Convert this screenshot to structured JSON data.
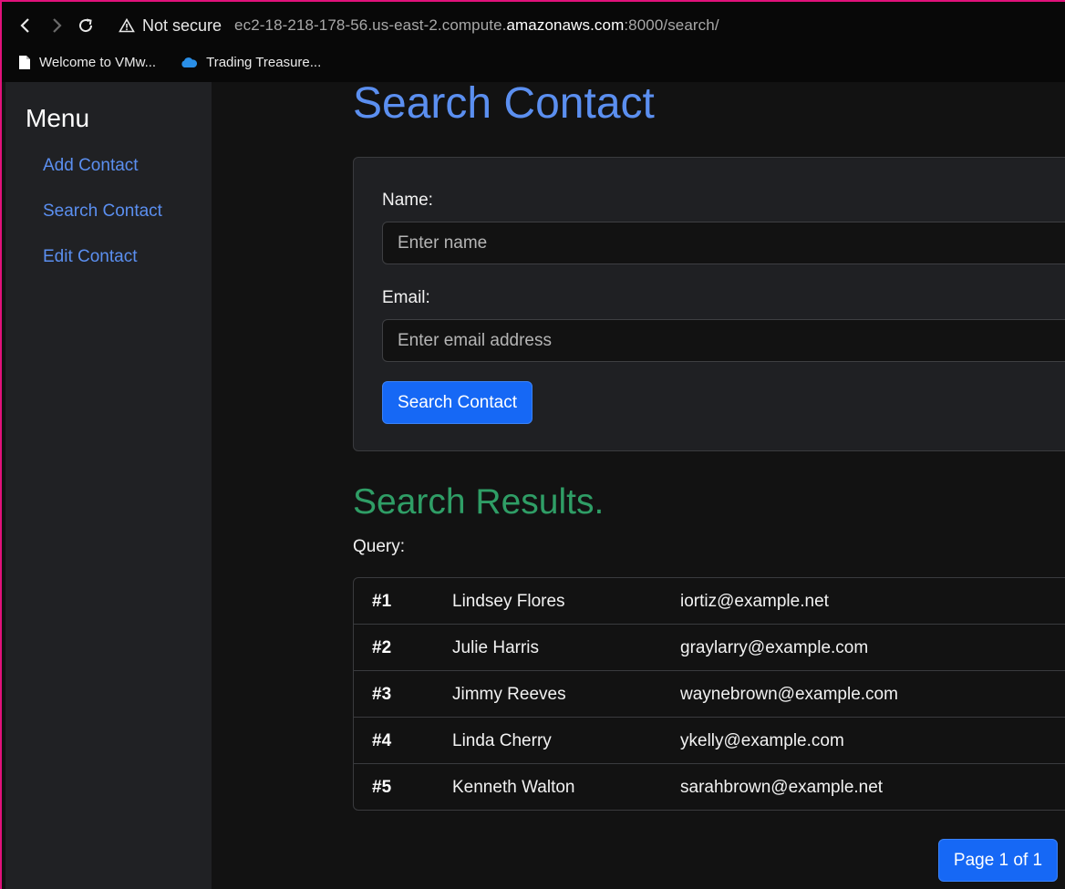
{
  "browser": {
    "security_label": "Not secure",
    "url_prefix": "ec2-18-218-178-56.us-east-2.compute.",
    "url_host": "amazonaws.com",
    "url_suffix": ":8000/search/",
    "bookmarks": [
      {
        "label": "Welcome to VMw...",
        "icon": "document-icon"
      },
      {
        "label": "Trading Treasure...",
        "icon": "cloud-icon"
      }
    ]
  },
  "sidebar": {
    "title": "Menu",
    "items": [
      {
        "label": "Add Contact"
      },
      {
        "label": "Search Contact"
      },
      {
        "label": "Edit Contact"
      }
    ]
  },
  "main": {
    "title": "Search Contact",
    "form": {
      "name_label": "Name:",
      "name_placeholder": "Enter name",
      "email_label": "Email:",
      "email_placeholder": "Enter email address",
      "submit_label": "Search Contact"
    },
    "results_title": "Search Results.",
    "query_label": "Query:",
    "results": [
      {
        "index": "#1",
        "name": "Lindsey Flores",
        "email": "iortiz@example.net"
      },
      {
        "index": "#2",
        "name": "Julie Harris",
        "email": "graylarry@example.com"
      },
      {
        "index": "#3",
        "name": "Jimmy Reeves",
        "email": "waynebrown@example.com"
      },
      {
        "index": "#4",
        "name": "Linda Cherry",
        "email": "ykelly@example.com"
      },
      {
        "index": "#5",
        "name": "Kenneth Walton",
        "email": "sarahbrown@example.net"
      }
    ],
    "pagination": "Page 1 of 1"
  },
  "colors": {
    "accent": "#1668f5",
    "link": "#5b8ff0",
    "results_title": "#2f9e66",
    "window_border": "#e0117a"
  }
}
